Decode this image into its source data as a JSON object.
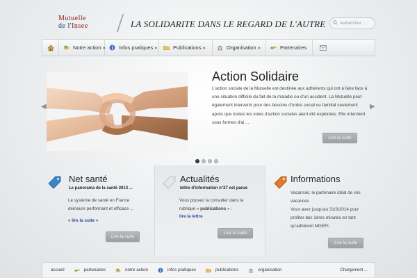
{
  "header": {
    "logo_line1": "Mutuelle",
    "logo_line2_a": "de l'",
    "logo_line2_b": "Insee",
    "tagline": "LA SOLIDARITE DANS LE REGARD DE L'AUTRE",
    "search_placeholder": "rechercher ..."
  },
  "nav": {
    "items": [
      {
        "label": "Notre action »",
        "icon": "hands-icon"
      },
      {
        "label": "Infos pratiques »",
        "icon": "info-icon"
      },
      {
        "label": "Publications »",
        "icon": "folder-icon"
      },
      {
        "label": "Organisation »",
        "icon": "building-icon"
      },
      {
        "label": "Partenaires",
        "icon": "handshake-icon"
      }
    ]
  },
  "slider": {
    "title": "Action Solidaire",
    "text": "L'action sociale de la Mutuelle est destinée aux adhérents qui ont à faire face à une situation difficile du fait de la maladie ou d'un accident. La Mutuelle peut également intervenir pour des besoins d'ordre social ou familial seulement après que toutes les voies d'action sociales aient été explorées. Elle intervient sous formes d'ai ...",
    "button": "Lire la suite"
  },
  "columns": {
    "net_sante": {
      "title": "Net santé",
      "subtitle": "Le panorama de la santé 2013 ...",
      "text_line1": "Le système de santé en France",
      "text_line2": "demeure performant et efficace ...",
      "link": "« lire la suite »",
      "button": "Lire la suite"
    },
    "actualites": {
      "title": "Actualités",
      "subtitle": "lettre d'information n°27 est parue",
      "text_line1": "Vous pouvez la consulter dans la",
      "text_line2_a": "rubrique « ",
      "text_line2_b": "publications",
      "text_line2_c": " » :",
      "link": "lire la lettre",
      "button": "Lire la suite"
    },
    "informations": {
      "title": "Informations",
      "line1": "Vacanciel, le partenaire idéal de vos",
      "line2": "vacances",
      "line3": "Vous avez jusqu'au 31/3/2014 pour",
      "line4": "profiter des 1ères minutes en tant",
      "line5": "qu'adhérent MGEFI.",
      "button": "Lire la suite"
    }
  },
  "footer": {
    "items": [
      {
        "label": "accueil",
        "icon": ""
      },
      {
        "label": "partenaires",
        "icon": "handshake-icon"
      },
      {
        "label": "notre action",
        "icon": "hands-icon"
      },
      {
        "label": "infos pratiques",
        "icon": "info-icon"
      },
      {
        "label": "publications",
        "icon": "folder-icon"
      },
      {
        "label": "organisation",
        "icon": "building-icon"
      }
    ],
    "loading": "Chargement ..."
  }
}
